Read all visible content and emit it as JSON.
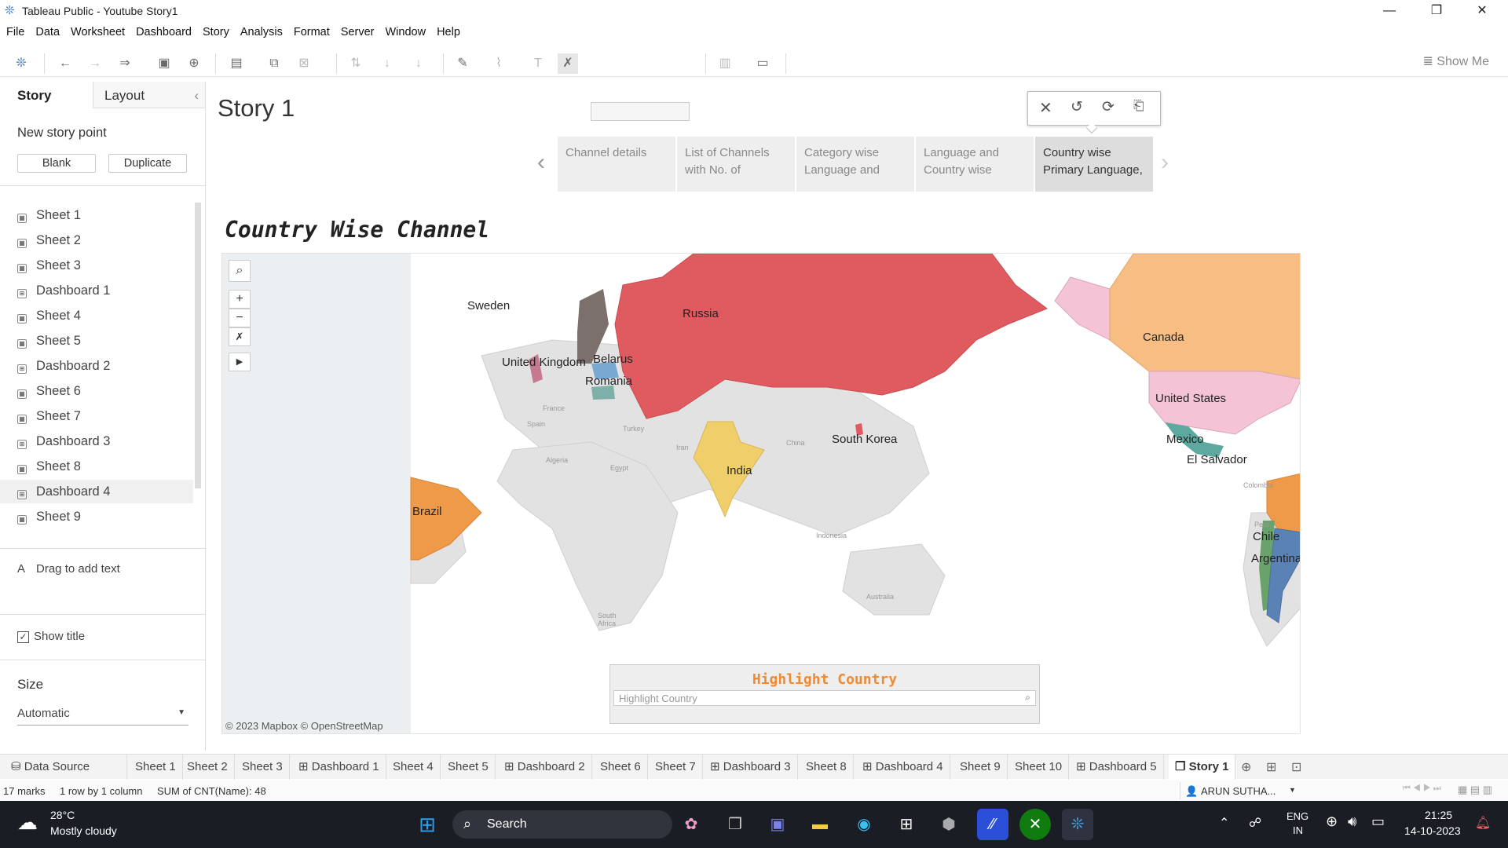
{
  "window": {
    "title": "Tableau Public - Youtube Story1",
    "min": "—",
    "max": "❐",
    "close": "✕"
  },
  "menu": [
    "File",
    "Data",
    "Worksheet",
    "Dashboard",
    "Story",
    "Analysis",
    "Format",
    "Server",
    "Window",
    "Help"
  ],
  "toolbar": {
    "show_me": "Show Me"
  },
  "left": {
    "tab_story": "Story",
    "tab_layout": "Layout",
    "new_story_point": "New story point",
    "blank": "Blank",
    "duplicate": "Duplicate",
    "sheets": [
      {
        "name": "Sheet 1",
        "type": "sheet"
      },
      {
        "name": "Sheet 2",
        "type": "sheet"
      },
      {
        "name": "Sheet 3",
        "type": "sheet"
      },
      {
        "name": "Dashboard 1",
        "type": "dashboard"
      },
      {
        "name": "Sheet 4",
        "type": "sheet"
      },
      {
        "name": "Sheet 5",
        "type": "sheet"
      },
      {
        "name": "Dashboard 2",
        "type": "dashboard"
      },
      {
        "name": "Sheet 6",
        "type": "sheet"
      },
      {
        "name": "Sheet 7",
        "type": "sheet"
      },
      {
        "name": "Dashboard 3",
        "type": "dashboard"
      },
      {
        "name": "Sheet 8",
        "type": "sheet"
      },
      {
        "name": "Dashboard 4",
        "type": "dashboard"
      },
      {
        "name": "Sheet 9",
        "type": "sheet"
      }
    ],
    "drag_text": "Drag to add text",
    "show_title": "Show title",
    "size_label": "Size",
    "size_value": "Automatic"
  },
  "story": {
    "title": "Story 1",
    "points": [
      {
        "line1": "Channel details",
        "line2": ""
      },
      {
        "line1": "List of Channels",
        "line2": "with No. of"
      },
      {
        "line1": "Category wise",
        "line2": "Language and"
      },
      {
        "line1": "Language and",
        "line2": "Country wise"
      },
      {
        "line1": "Country wise",
        "line2": "Primary Language,"
      }
    ],
    "active_point": 4
  },
  "viz": {
    "title": "Country Wise Channel",
    "countries": [
      {
        "name": "Russia",
        "color": "#e05b5f"
      },
      {
        "name": "Sweden",
        "color": "#7b706c"
      },
      {
        "name": "United Kingdom",
        "color": "#c47a8f"
      },
      {
        "name": "Belarus",
        "color": "#79a8d3"
      },
      {
        "name": "Romania",
        "color": "#7db0a8"
      },
      {
        "name": "South Korea",
        "color": "#e05b5f"
      },
      {
        "name": "India",
        "color": "#f0cf6b"
      },
      {
        "name": "Canada",
        "color": "#f7bd83"
      },
      {
        "name": "United States",
        "color": "#f4c4d6"
      },
      {
        "name": "Mexico",
        "color": "#5da9a0"
      },
      {
        "name": "El Salvador",
        "color": "#5da9a0"
      },
      {
        "name": "Brazil",
        "color": "#ef9a48"
      },
      {
        "name": "Chile",
        "color": "#6aa26c"
      },
      {
        "name": "Argentina",
        "color": "#5b82b5"
      }
    ],
    "basemap_labels": [
      "Spain",
      "France",
      "Turkey",
      "Iran",
      "Algeria",
      "Egypt",
      "China",
      "Indonesia",
      "Australia",
      "South Africa",
      "Colombia",
      "Peru"
    ],
    "attribution": "© 2023 Mapbox © OpenStreetMap",
    "highlight_title": "Highlight Country",
    "highlight_placeholder": "Highlight Country"
  },
  "tabs": [
    {
      "name": "Data Source",
      "icon": "⛁"
    },
    {
      "name": "Sheet 1",
      "icon": ""
    },
    {
      "name": "Sheet 2",
      "icon": ""
    },
    {
      "name": "Sheet 3",
      "icon": ""
    },
    {
      "name": "Dashboard 1",
      "icon": "⊞"
    },
    {
      "name": "Sheet 4",
      "icon": ""
    },
    {
      "name": "Sheet 5",
      "icon": ""
    },
    {
      "name": "Dashboard 2",
      "icon": "⊞"
    },
    {
      "name": "Sheet 6",
      "icon": ""
    },
    {
      "name": "Sheet 7",
      "icon": ""
    },
    {
      "name": "Dashboard 3",
      "icon": "⊞"
    },
    {
      "name": "Sheet 8",
      "icon": ""
    },
    {
      "name": "Dashboard 4",
      "icon": "⊞"
    },
    {
      "name": "Sheet 9",
      "icon": ""
    },
    {
      "name": "Sheet 10",
      "icon": ""
    },
    {
      "name": "Dashboard 5",
      "icon": "⊞"
    },
    {
      "name": "Story 1",
      "icon": "❐"
    }
  ],
  "status": {
    "marks": "17 marks",
    "rows": "1 row by 1 column",
    "sum": "SUM of CNT(Name): 48",
    "user": "ARUN SUTHA..."
  },
  "taskbar": {
    "temp": "28°C",
    "weather": "Mostly cloudy",
    "search": "Search",
    "lang1": "ENG",
    "lang2": "IN",
    "time": "21:25",
    "date": "14-10-2023"
  }
}
